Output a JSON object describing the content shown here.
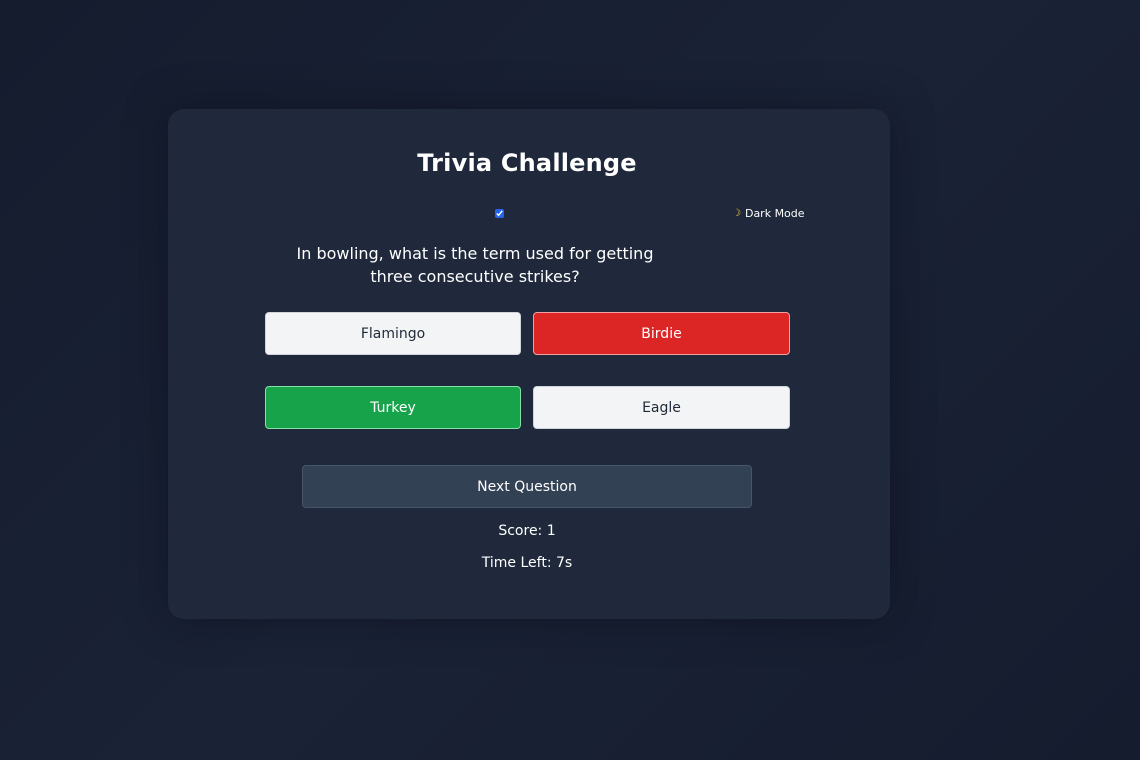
{
  "quiz": {
    "title": "Trivia Challenge",
    "theme_toggle": {
      "checked": true,
      "label": "Dark Mode",
      "icon": "moon-icon"
    },
    "question": "In bowling, what is the term used for getting three consecutive strikes?",
    "answers": [
      {
        "label": "Flamingo",
        "state": "neutral"
      },
      {
        "label": "Birdie",
        "state": "wrong"
      },
      {
        "label": "Turkey",
        "state": "correct"
      },
      {
        "label": "Eagle",
        "state": "neutral"
      }
    ],
    "next_label": "Next Question",
    "score_text": "Score: 1",
    "time_text": "Time Left: 7s"
  },
  "colors": {
    "background": "#151c2e",
    "card": "#1f293b",
    "wrong": "#dc2626",
    "correct": "#16a34a",
    "neutral": "#f3f4f6",
    "next_button": "#334155",
    "accent": "#2563eb"
  }
}
